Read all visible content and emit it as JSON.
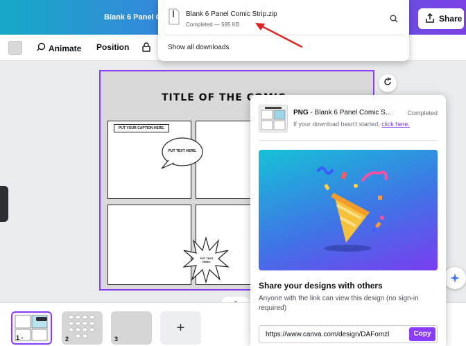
{
  "topbar": {
    "doc_title": "Blank 6 Panel C",
    "share_label": "Share",
    "accent_gradient": [
      "#16a9c6",
      "#3f7de0",
      "#7b3fe4"
    ]
  },
  "toolbar": {
    "animate_label": "Animate",
    "position_label": "Position"
  },
  "downloads": {
    "file_name": "Blank 6 Panel Comic Strip.zip",
    "status": "Completed — 595 KB",
    "show_all": "Show all downloads"
  },
  "canvas": {
    "comic_title": "TITLE OF THE COMIC ",
    "caption": "PUT YOUR CAPTION HERE.",
    "speech_bubble": "PUT TEXT HERE.",
    "burst_text": "PUT TEXT HERE."
  },
  "share_panel": {
    "format": "PNG",
    "file_title": " - Blank 6 Panel Comic S...",
    "status": "Completed",
    "hint_prefix": "If your download hasn't started, ",
    "hint_link": "click here.",
    "heading": "Share your designs with others",
    "description": "Anyone with the link can view this design (no sign-in required)",
    "url": "https://www.canva.com/design/DAFomzl",
    "copy_label": "Copy",
    "accent": "#8b3dff"
  },
  "pages": {
    "items": [
      {
        "label": "1 -"
      },
      {
        "label": "2"
      },
      {
        "label": "3"
      }
    ],
    "add_label": "+"
  }
}
